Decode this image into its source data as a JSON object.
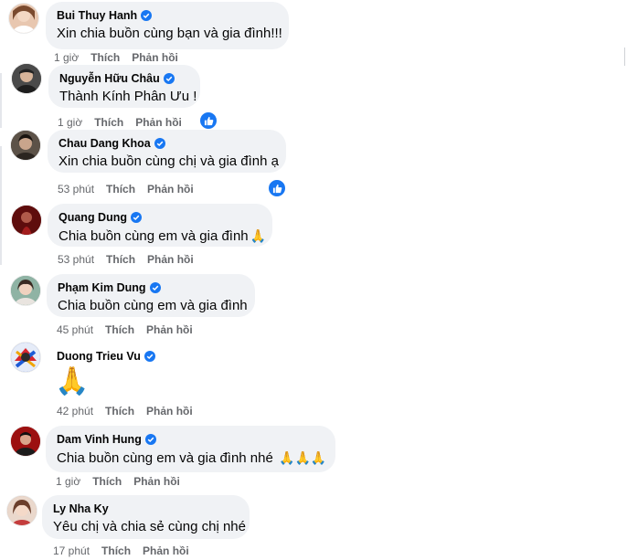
{
  "comments": [
    {
      "name": "Bui Thuy Hanh",
      "text": "Xin chia buồn cùng bạn và gia đình!!!",
      "time": "1 giờ",
      "like": "Thích",
      "reply": "Phản hồi",
      "verified": true,
      "avatar_color": "#e8c7b0",
      "reaction": ""
    },
    {
      "name": "Nguyễn Hữu Châu",
      "text": "Thành Kính Phân Ưu !",
      "time": "1 giờ",
      "like": "Thích",
      "reply": "Phản hồi",
      "verified": true,
      "avatar_color": "#5a5a5a",
      "reaction": "like-icon"
    },
    {
      "name": "Chau Dang Khoa",
      "text": "Xin chia buồn cùng chị và gia đình ạ",
      "time": "53 phút",
      "like": "Thích",
      "reply": "Phản hồi",
      "verified": true,
      "avatar_color": "#3a3530",
      "reaction": "like-icon"
    },
    {
      "name": "Quang Dung",
      "text": "Chia buồn cùng em và gia đình",
      "time": "53 phút",
      "like": "Thích",
      "reply": "Phản hồi",
      "verified": true,
      "avatar_color": "#8b1a1a",
      "reaction": "",
      "emoji": "🙏"
    },
    {
      "name": "Phạm Kim Dung",
      "text": "Chia buồn cùng em và gia đình",
      "time": "45 phút",
      "like": "Thích",
      "reply": "Phản hồi",
      "verified": true,
      "avatar_color": "#6f9a8a",
      "reaction": ""
    },
    {
      "name": "Duong Trieu Vu",
      "text": "",
      "time": "42 phút",
      "like": "Thích",
      "reply": "Phản hồi",
      "verified": true,
      "avatar_color": "#3b63c9",
      "reaction": "",
      "emoji": "🙏"
    },
    {
      "name": "Dam Vinh Hung",
      "text": "Chia buồn cùng em và gia đình nhé",
      "time": "1 giờ",
      "like": "Thích",
      "reply": "Phản hồi",
      "verified": true,
      "avatar_color": "#b01818",
      "reaction": "",
      "emoji": "🙏🙏🙏"
    },
    {
      "name": "Ly Nha Ky",
      "text": "Yêu chị và chia sẻ cùng chị nhé",
      "time": "17 phút",
      "like": "Thích",
      "reply": "Phản hồi",
      "verified": false,
      "avatar_color": "#c49a85",
      "reaction": ""
    }
  ],
  "colors": {
    "bubble": "#f0f2f5",
    "meta": "#65676b",
    "verified": "#1877f2",
    "like_reaction": "#1877f2"
  }
}
